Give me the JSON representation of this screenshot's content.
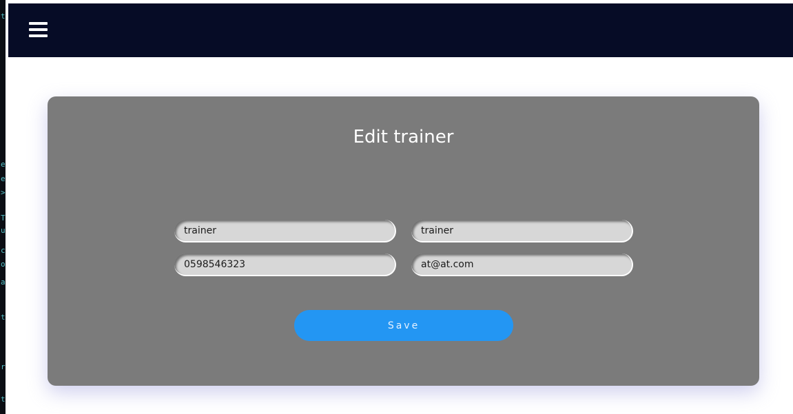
{
  "window_strip": {
    "glyphs": [
      "t",
      "e",
      "e",
      ">",
      "T",
      "u",
      "c",
      "o",
      "a",
      "t",
      "r",
      "t"
    ]
  },
  "header": {
    "menu_icon": "hamburger-menu-icon",
    "background_color": "#060c26"
  },
  "form": {
    "title": "Edit trainer",
    "fields": {
      "first_name": {
        "value": "trainer"
      },
      "last_name": {
        "value": "trainer"
      },
      "phone": {
        "value": "0598546323"
      },
      "email": {
        "value": "at@at.com"
      }
    },
    "save_label": "Save",
    "card_color": "#7b7b7b",
    "accent_color": "#2396f3"
  }
}
